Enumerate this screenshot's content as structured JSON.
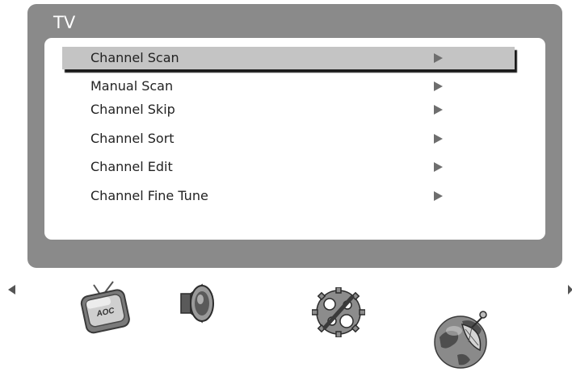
{
  "menu": {
    "title": "TV",
    "items": [
      {
        "label": "Channel Scan",
        "selected": true
      },
      {
        "label": "Manual Scan"
      },
      {
        "label": "Channel Skip"
      },
      {
        "label": "Channel Sort"
      },
      {
        "label": "Channel Edit"
      },
      {
        "label": "Channel Fine Tune"
      }
    ]
  },
  "bottom_bar": {
    "icons": [
      {
        "name": "tv-icon",
        "text": "AOC"
      },
      {
        "name": "speaker-icon"
      },
      {
        "name": "settings-gears-icon"
      },
      {
        "name": "satellite-globe-icon"
      }
    ]
  },
  "colors": {
    "panel": "#8a8a8a",
    "selection": "#c4c4c4",
    "arrow": "#6e6e6e"
  }
}
